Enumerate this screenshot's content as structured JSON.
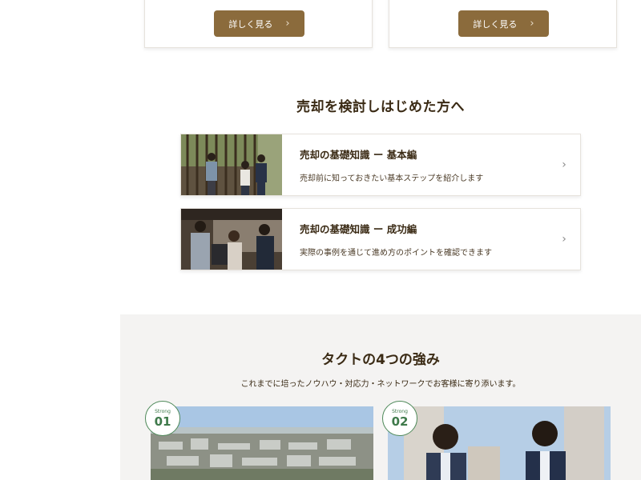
{
  "cards": [
    {
      "button_label": "詳しく見る"
    },
    {
      "button_label": "詳しく見る"
    }
  ],
  "seller_section": {
    "title": "売却を検討しはじめた方へ",
    "guides": [
      {
        "title": "売却の基礎知識 ー 基本編",
        "description": "売却前に知っておきたい基本ステップを紹介します"
      },
      {
        "title": "売却の基礎知識 ー 成功編",
        "description": "実際の事例を通じて進め方のポイントを確認できます"
      }
    ]
  },
  "strengths": {
    "title": "タクトの4つの強み",
    "subtitle": "これまでに培ったノウハウ・対応力・ネットワークでお客様に寄り添います。",
    "items": [
      {
        "label": "Strong",
        "number": "01"
      },
      {
        "label": "Strong",
        "number": "02"
      }
    ]
  },
  "colors": {
    "accent": "#8b6b3c",
    "badge_green": "#3f7a4b",
    "band_bg": "#f4f3f2"
  },
  "icons": {
    "button_arrow": "chevron-right-icon",
    "row_arrow": "chevron-right-icon"
  }
}
